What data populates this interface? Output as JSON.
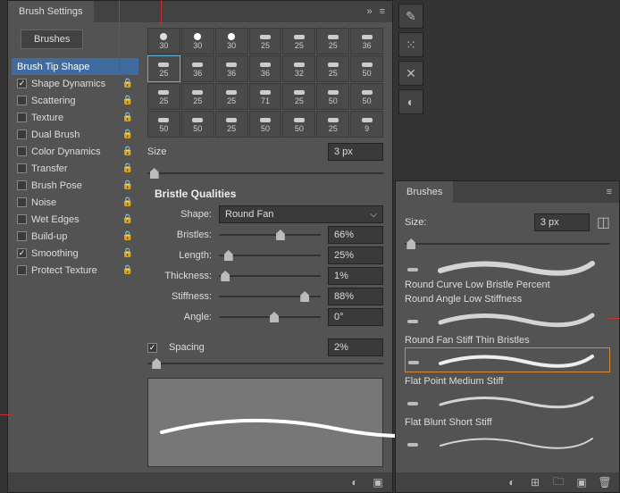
{
  "panel_title": "Brush Settings",
  "brushes_button": "Brushes",
  "options": [
    {
      "label": "Brush Tip Shape",
      "selected": true,
      "hasCheckbox": false
    },
    {
      "label": "Shape Dynamics",
      "checked": true,
      "lock": true
    },
    {
      "label": "Scattering",
      "checked": false,
      "lock": true
    },
    {
      "label": "Texture",
      "checked": false,
      "lock": true
    },
    {
      "label": "Dual Brush",
      "checked": false,
      "lock": true
    },
    {
      "label": "Color Dynamics",
      "checked": false,
      "lock": true
    },
    {
      "label": "Transfer",
      "checked": false,
      "lock": true
    },
    {
      "label": "Brush Pose",
      "checked": false,
      "lock": true
    },
    {
      "label": "Noise",
      "checked": false,
      "lock": true
    },
    {
      "label": "Wet Edges",
      "checked": false,
      "lock": true
    },
    {
      "label": "Build-up",
      "checked": false,
      "lock": true
    },
    {
      "label": "Smoothing",
      "checked": true,
      "lock": true
    },
    {
      "label": "Protect Texture",
      "checked": false,
      "lock": true
    }
  ],
  "tip_grid": {
    "rows": [
      [
        30,
        30,
        30,
        25,
        25,
        25,
        36
      ],
      [
        25,
        36,
        36,
        36,
        32,
        25,
        50
      ],
      [
        25,
        25,
        25,
        71,
        25,
        50,
        50
      ],
      [
        50,
        50,
        25,
        50,
        50,
        25,
        9
      ]
    ],
    "selected": {
      "row": 1,
      "col": 0
    }
  },
  "size": {
    "label": "Size",
    "value": "3 px"
  },
  "section": "Bristle Qualities",
  "shape": {
    "label": "Shape:",
    "value": "Round Fan"
  },
  "bristles": {
    "label": "Bristles:",
    "value": "66%",
    "pos": 56
  },
  "length": {
    "label": "Length:",
    "value": "25%",
    "pos": 5
  },
  "thickness": {
    "label": "Thickness:",
    "value": "1%",
    "pos": 2
  },
  "stiffness": {
    "label": "Stiffness:",
    "value": "88%",
    "pos": 80
  },
  "angle": {
    "label": "Angle:",
    "value": "0°",
    "pos": 50
  },
  "spacing": {
    "label": "Spacing",
    "value": "2%",
    "pos": 2,
    "checked": true
  },
  "brushes_panel": {
    "title": "Brushes",
    "size_label": "Size:",
    "size_value": "3 px",
    "items": [
      {
        "name": "Round Curve Low Bristle Percent",
        "selected": false
      },
      {
        "name": "Round Angle Low Stiffness",
        "selected": false
      },
      {
        "name": "Round Fan Stiff Thin Bristles",
        "selected": true
      },
      {
        "name": "Flat Point Medium Stiff",
        "selected": false
      },
      {
        "name": "Flat Blunt Short Stiff",
        "selected": false
      }
    ]
  }
}
